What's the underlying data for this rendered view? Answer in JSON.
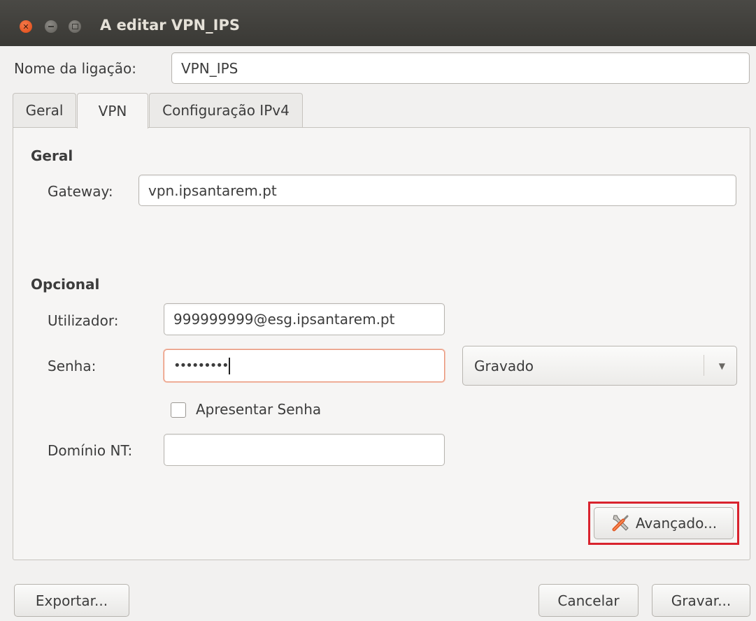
{
  "window": {
    "title": "A editar VPN_IPS"
  },
  "connection": {
    "name_label": "Nome da ligação:",
    "name_value": "VPN_IPS"
  },
  "tabs": [
    {
      "label": "Geral",
      "active": false
    },
    {
      "label": "VPN",
      "active": true
    },
    {
      "label": "Configuração IPv4",
      "active": false
    }
  ],
  "vpn": {
    "general_heading": "Geral",
    "gateway_label": "Gateway:",
    "gateway_value": "vpn.ipsantarem.pt",
    "optional_heading": "Opcional",
    "user_label": "Utilizador:",
    "user_value": "999999999@esg.ipsantarem.pt",
    "password_label": "Senha:",
    "password_value": "•••••••••",
    "password_storage": "Gravado",
    "show_password_label": "Apresentar Senha",
    "show_password_checked": false,
    "nt_domain_label": "Domínio NT:",
    "nt_domain_value": "",
    "advanced_button": "Avançado..."
  },
  "footer": {
    "export_button": "Exportar...",
    "cancel_button": "Cancelar",
    "save_button": "Gravar..."
  },
  "colors": {
    "titlebar": "#3c3b37",
    "highlight": "#d9232e",
    "focus_border": "#e8957a",
    "close_button": "#dd4814"
  },
  "icons": {
    "advanced": "tools-icon",
    "dropdown": "chevron-down-icon"
  }
}
